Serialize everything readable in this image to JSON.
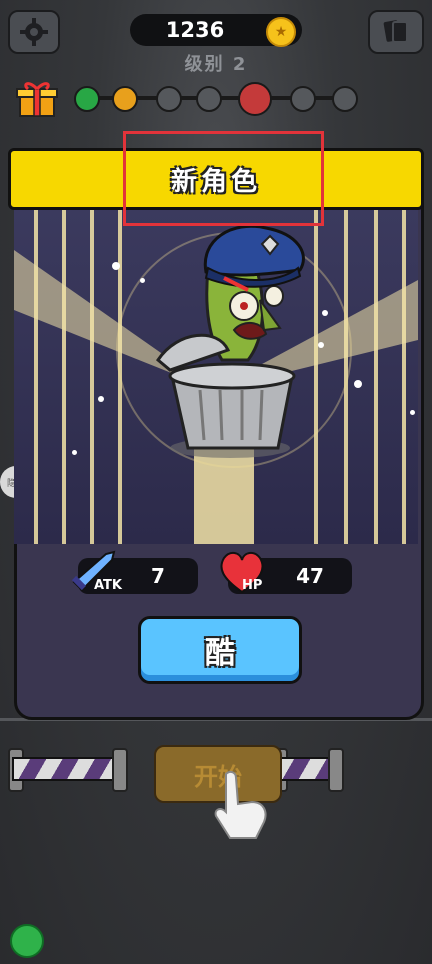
{
  "header": {
    "coins": "1236",
    "level_label": "级别 2"
  },
  "modal": {
    "title": "新角色",
    "stats": {
      "atk_label": "ATK",
      "atk_value": "7",
      "hp_label": "HP",
      "hp_value": "47"
    },
    "confirm_label": "酷"
  },
  "footer": {
    "start_label": "开始"
  },
  "side": {
    "badge_text": "隐私"
  },
  "progress": {
    "stages": [
      "cleared-green",
      "cleared-orange",
      "locked",
      "locked",
      "locked",
      "boss",
      "locked",
      "locked"
    ],
    "current_stage_index": 1
  },
  "colors": {
    "banner": "#f7d800",
    "highlight_box": "#e2333a",
    "confirm_button": "#5ac4ff",
    "panel": "#3a3650"
  }
}
